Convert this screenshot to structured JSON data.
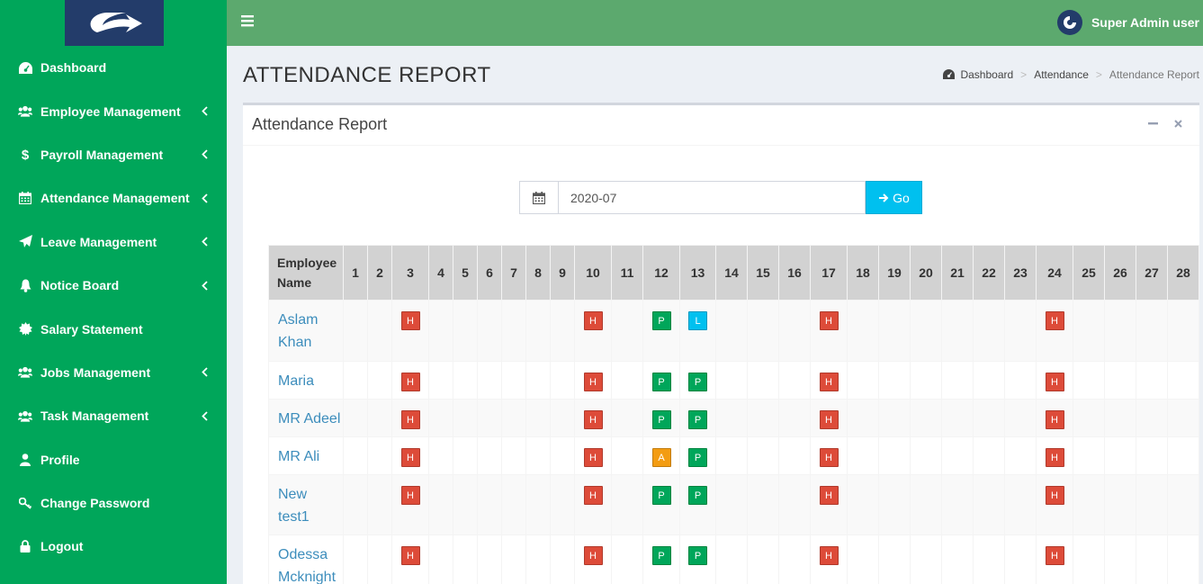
{
  "topbar": {
    "user_name": "Super Admin user"
  },
  "sidebar": {
    "items": [
      {
        "label": "Dashboard",
        "icon": "dashboard-icon",
        "has_submenu": false
      },
      {
        "label": "Employee Management",
        "icon": "users-icon",
        "has_submenu": true
      },
      {
        "label": "Payroll Management",
        "icon": "dollar-icon",
        "has_submenu": true
      },
      {
        "label": "Attendance Management",
        "icon": "calendar-icon",
        "has_submenu": true
      },
      {
        "label": "Leave Management",
        "icon": "paper-plane-icon",
        "has_submenu": true
      },
      {
        "label": "Notice Board",
        "icon": "bell-icon",
        "has_submenu": true
      },
      {
        "label": "Salary Statement",
        "icon": "certificate-icon",
        "has_submenu": false
      },
      {
        "label": "Jobs Management",
        "icon": "users-icon",
        "has_submenu": true
      },
      {
        "label": "Task Management",
        "icon": "users-icon",
        "has_submenu": true
      },
      {
        "label": "Profile",
        "icon": "user-icon",
        "has_submenu": false
      },
      {
        "label": "Change Password",
        "icon": "key-icon",
        "has_submenu": false
      },
      {
        "label": "Logout",
        "icon": "lock-icon",
        "has_submenu": false
      }
    ]
  },
  "header": {
    "title": "ATTENDANCE REPORT",
    "breadcrumb": [
      "Dashboard",
      "Attendance",
      "Attendance Report"
    ]
  },
  "box": {
    "title": "Attendance Report"
  },
  "filter": {
    "month_value": "2020-07",
    "go_label": "Go"
  },
  "table": {
    "name_header": [
      "Employee",
      "Name"
    ],
    "days": [
      "1",
      "2",
      "3",
      "4",
      "5",
      "6",
      "7",
      "8",
      "9",
      "10",
      "11",
      "12",
      "13",
      "14",
      "15",
      "16",
      "17",
      "18",
      "19",
      "20",
      "21",
      "22",
      "23",
      "24",
      "25",
      "26",
      "27",
      "28"
    ],
    "rows": [
      {
        "name": [
          "Aslam",
          "Khan"
        ],
        "marks": {
          "3": "H",
          "10": "H",
          "12": "P",
          "13": "L",
          "17": "H",
          "24": "H"
        }
      },
      {
        "name": [
          "Maria"
        ],
        "marks": {
          "3": "H",
          "10": "H",
          "12": "P",
          "13": "P",
          "17": "H",
          "24": "H"
        }
      },
      {
        "name": [
          "MR Adeel"
        ],
        "marks": {
          "3": "H",
          "10": "H",
          "12": "P",
          "13": "P",
          "17": "H",
          "24": "H"
        }
      },
      {
        "name": [
          "MR Ali"
        ],
        "marks": {
          "3": "H",
          "10": "H",
          "12": "A",
          "13": "P",
          "17": "H",
          "24": "H"
        }
      },
      {
        "name": [
          "New",
          "test1"
        ],
        "marks": {
          "3": "H",
          "10": "H",
          "12": "P",
          "13": "P",
          "17": "H",
          "24": "H"
        }
      },
      {
        "name": [
          "Odessa",
          "Mcknight"
        ],
        "marks": {
          "3": "H",
          "10": "H",
          "12": "P",
          "13": "P",
          "17": "H",
          "24": "H"
        }
      }
    ]
  },
  "colors": {
    "sidebar": "#00a65a",
    "topbar": "#5ca96e",
    "logo_bg": "#233c6a",
    "holiday": "#dd4b39",
    "present": "#00a65a",
    "leave": "#00c0ef",
    "absent": "#f39c12",
    "link": "#3c8dbc"
  }
}
